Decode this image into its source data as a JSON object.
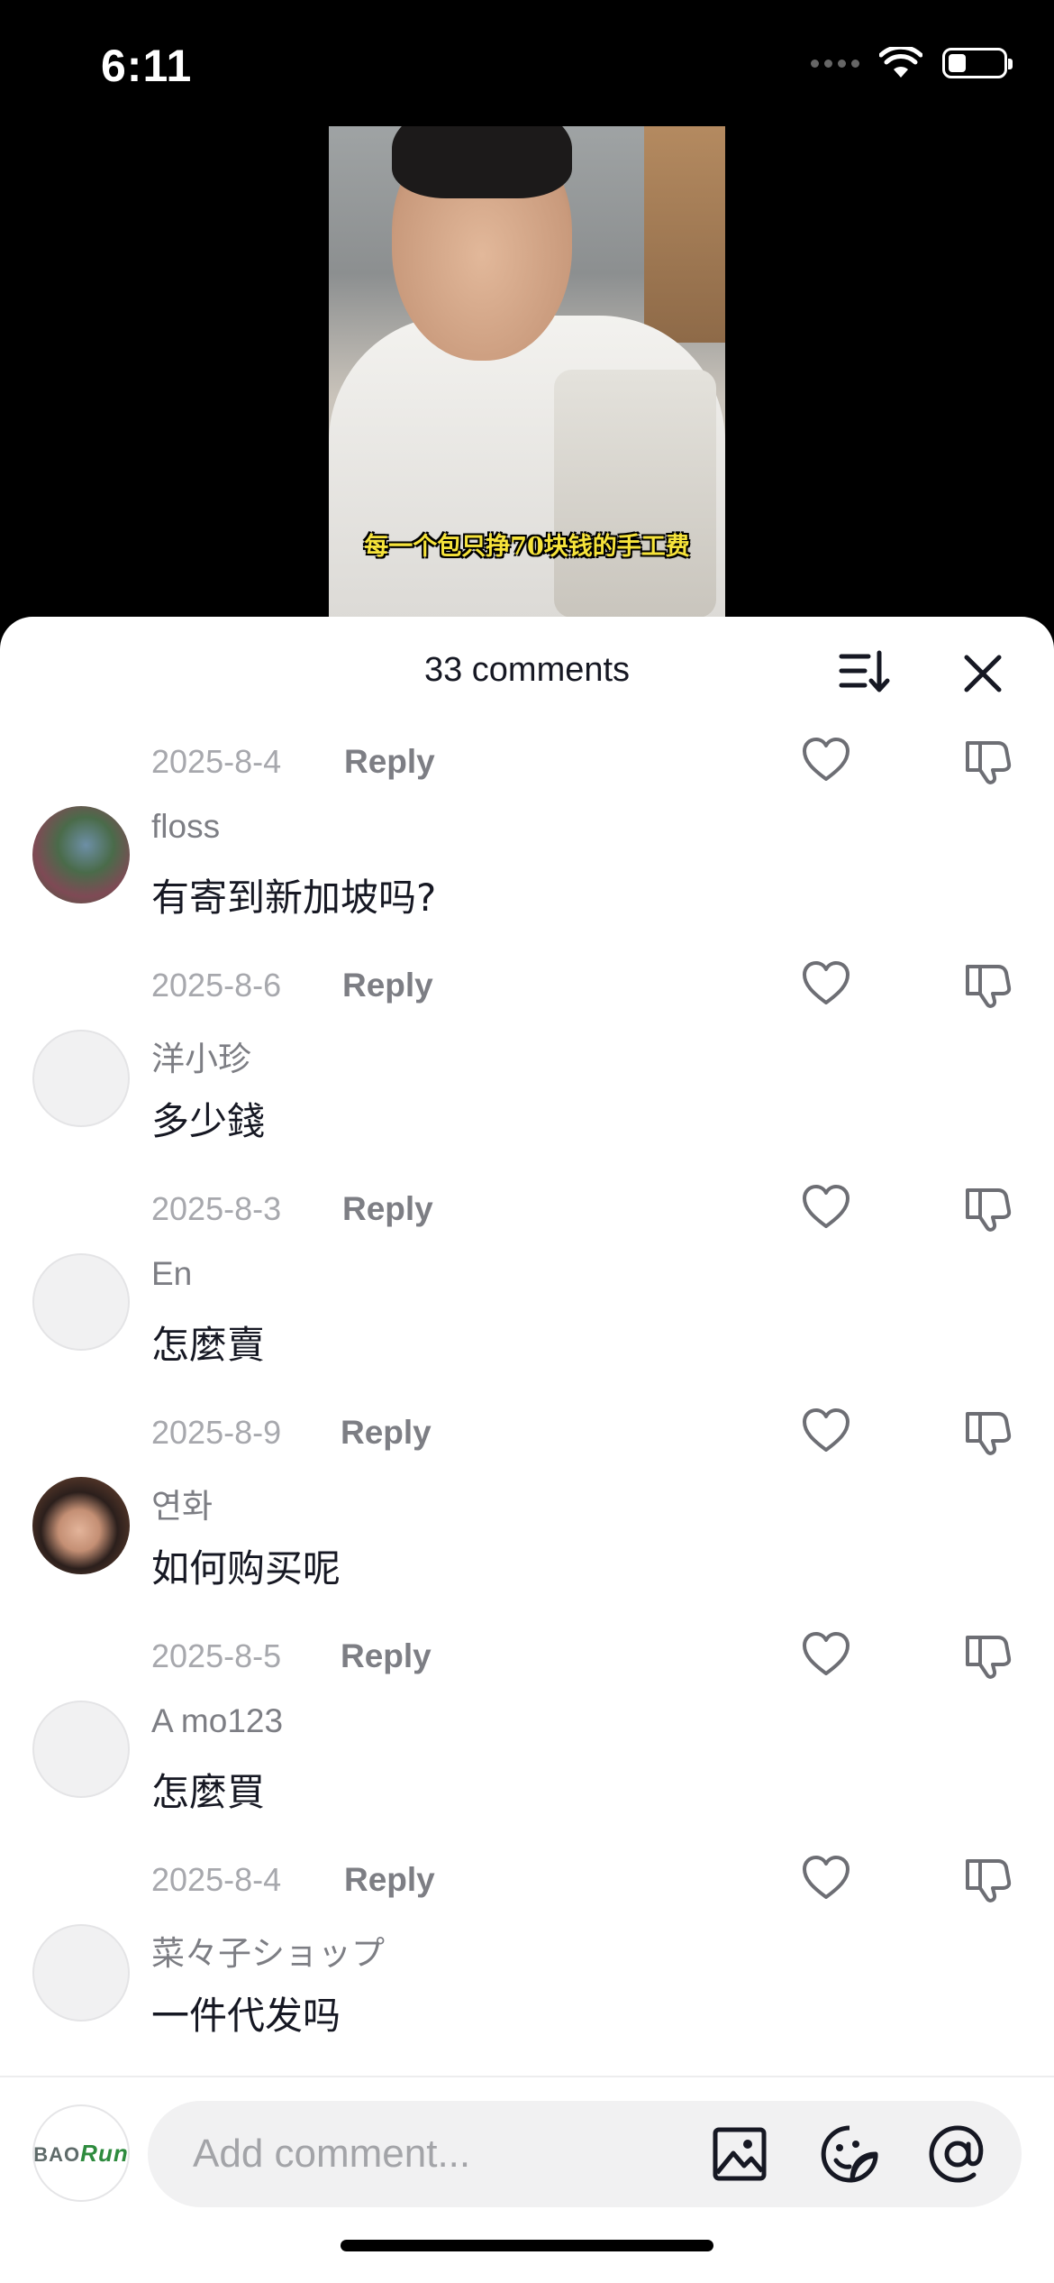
{
  "status_bar": {
    "time": "6:11"
  },
  "video": {
    "caption": "每一个包只挣70块钱的手工费"
  },
  "sheet": {
    "title": "33 comments"
  },
  "first_meta": {
    "date": "2025-8-4",
    "reply": "Reply"
  },
  "comments": [
    {
      "username": "floss",
      "text": "有寄到新加坡吗?",
      "date": "2025-8-6",
      "reply": "Reply"
    },
    {
      "username": "洋小珍",
      "text": "多少錢",
      "date": "2025-8-3",
      "reply": "Reply"
    },
    {
      "username": "En",
      "text": "怎麼賣",
      "date": "2025-8-9",
      "reply": "Reply"
    },
    {
      "username": "연화",
      "text": "如何购买呢",
      "date": "2025-8-5",
      "reply": "Reply"
    },
    {
      "username": "A mo123",
      "text": "怎麼買",
      "date": "2025-8-4",
      "reply": "Reply"
    },
    {
      "username": "菜々子ショップ",
      "text": "一件代发吗"
    }
  ],
  "input": {
    "placeholder": "Add comment...",
    "avatar_logo_left": "BAO",
    "avatar_logo_right": "Run"
  },
  "icons": {
    "sort": "sort-icon",
    "close": "close-icon",
    "like": "heart-icon",
    "dislike": "thumbs-down-icon",
    "image": "image-icon",
    "sticker": "sticker-icon",
    "mention": "at-icon"
  },
  "colors": {
    "primary_text": "#161823",
    "secondary_text": "#7d7e84",
    "muted_text": "#a7a8ad",
    "caption": "#f6e33a"
  }
}
